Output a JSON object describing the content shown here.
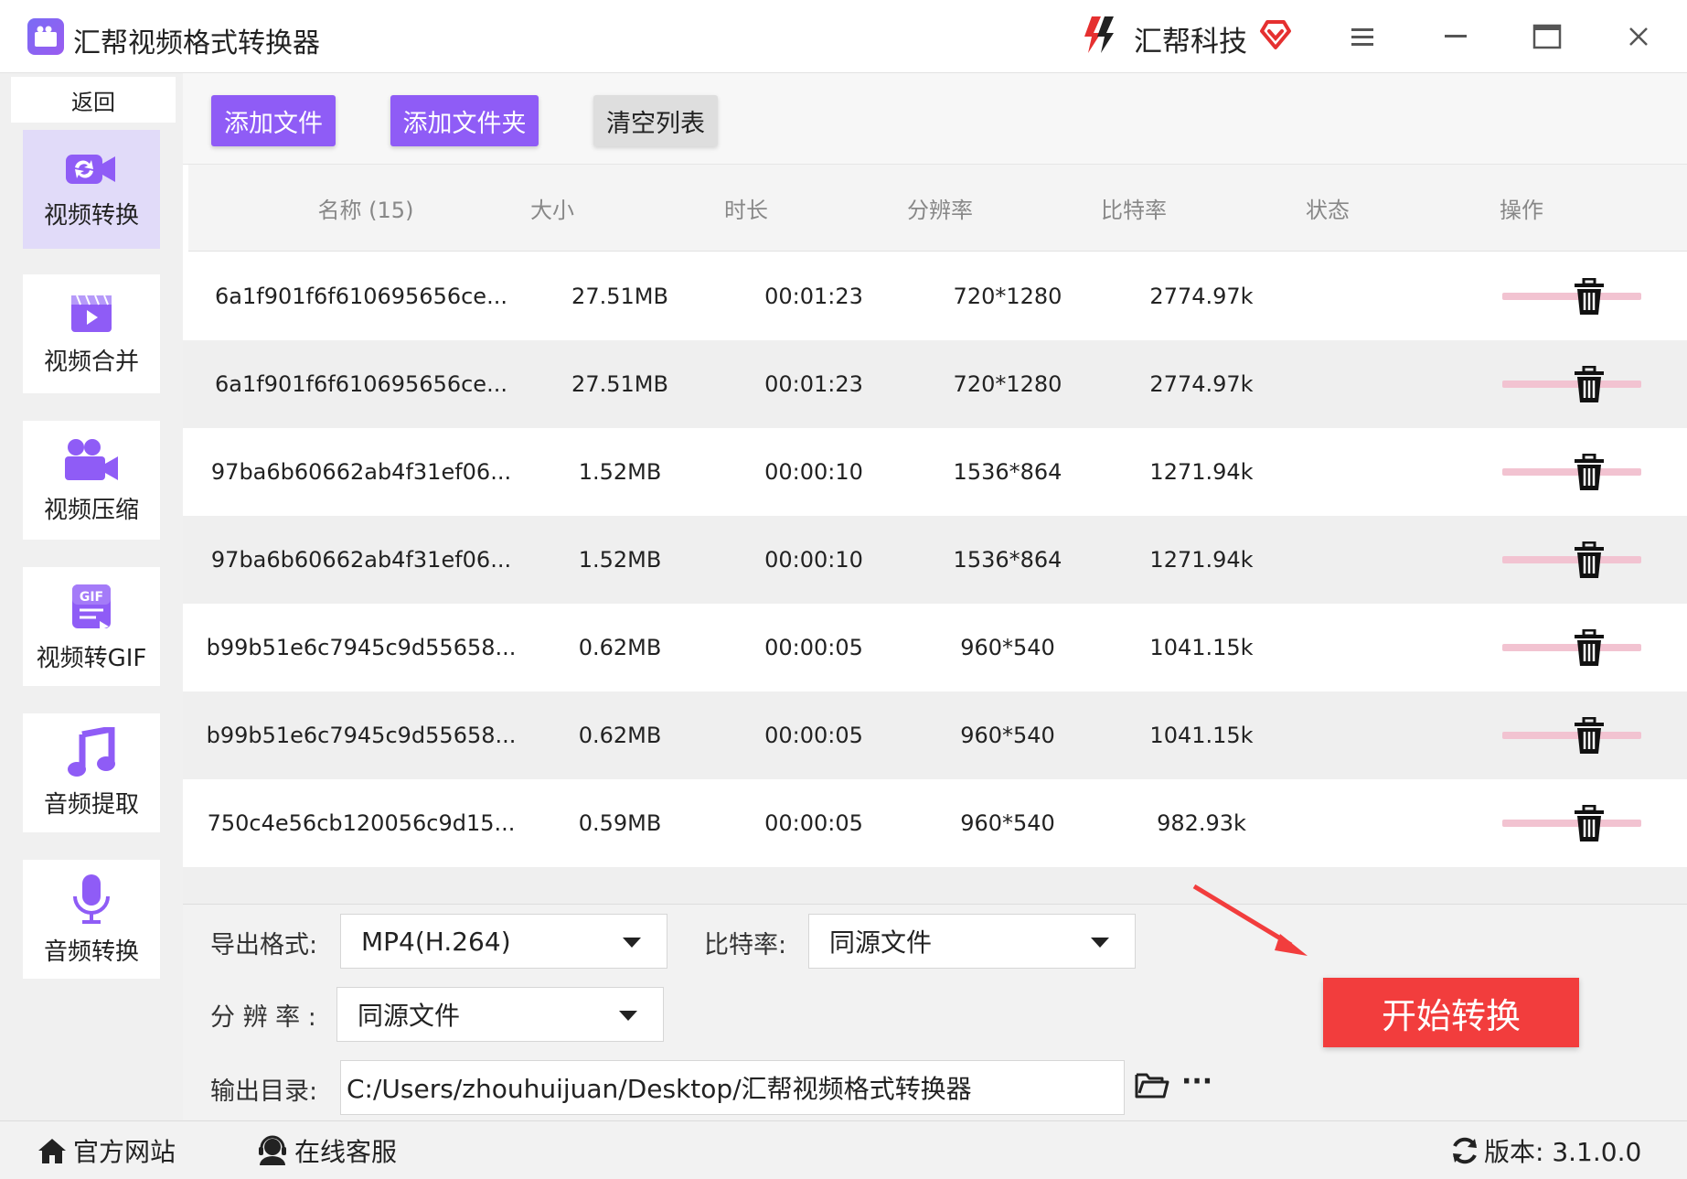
{
  "titlebar": {
    "app_title": "汇帮视频格式转换器",
    "brand_name": "汇帮科技",
    "icons": [
      "app-logo-icon",
      "brand-logo-icon",
      "brand-badge-icon",
      "menu-icon",
      "minimize-icon",
      "maximize-icon",
      "close-icon"
    ]
  },
  "sidebar": {
    "back_label": "返回",
    "items": [
      {
        "label": "视频转换",
        "icon": "video-convert-icon",
        "active": true
      },
      {
        "label": "视频合并",
        "icon": "video-merge-icon",
        "active": false
      },
      {
        "label": "视频压缩",
        "icon": "video-compress-icon",
        "active": false
      },
      {
        "label": "视频转GIF",
        "icon": "gif-icon",
        "active": false
      },
      {
        "label": "音频提取",
        "icon": "music-note-icon",
        "active": false
      },
      {
        "label": "音频转换",
        "icon": "microphone-icon",
        "active": false
      }
    ]
  },
  "toolbar": {
    "add_file": "添加文件",
    "add_folder": "添加文件夹",
    "clear_list": "清空列表"
  },
  "table": {
    "headers": {
      "name": "名称 (15)",
      "size": "大小",
      "duration": "时长",
      "resolution": "分辨率",
      "bitrate": "比特率",
      "status": "状态",
      "action": "操作"
    },
    "rows": [
      {
        "name": "6a1f901f6f610695656ce...",
        "size": "27.51MB",
        "duration": "00:01:23",
        "resolution": "720*1280",
        "bitrate": "2774.97k"
      },
      {
        "name": "6a1f901f6f610695656ce...",
        "size": "27.51MB",
        "duration": "00:01:23",
        "resolution": "720*1280",
        "bitrate": "2774.97k"
      },
      {
        "name": "97ba6b60662ab4f31ef06...",
        "size": "1.52MB",
        "duration": "00:00:10",
        "resolution": "1536*864",
        "bitrate": "1271.94k"
      },
      {
        "name": "97ba6b60662ab4f31ef06...",
        "size": "1.52MB",
        "duration": "00:00:10",
        "resolution": "1536*864",
        "bitrate": "1271.94k"
      },
      {
        "name": "b99b51e6c7945c9d55658...",
        "size": "0.62MB",
        "duration": "00:00:05",
        "resolution": "960*540",
        "bitrate": "1041.15k"
      },
      {
        "name": "b99b51e6c7945c9d55658...",
        "size": "0.62MB",
        "duration": "00:00:05",
        "resolution": "960*540",
        "bitrate": "1041.15k"
      },
      {
        "name": "750c4e56cb120056c9d15...",
        "size": "0.59MB",
        "duration": "00:00:05",
        "resolution": "960*540",
        "bitrate": "982.93k"
      }
    ]
  },
  "settings": {
    "format_label": "导出格式:",
    "format_value": "MP4(H.264)",
    "bitrate_label": "比特率:",
    "bitrate_value": "同源文件",
    "resolution_label": "分 辨 率 :",
    "resolution_value": "同源文件",
    "output_label": "输出目录:",
    "output_path": "C:/Users/zhouhuijuan/Desktop/汇帮视频格式转换器",
    "more_label": "···",
    "start_button": "开始转换"
  },
  "footer": {
    "website": "官方网站",
    "support": "在线客服",
    "version": "版本: 3.1.0.0"
  },
  "colors": {
    "accent_purple": "#8f5cf6",
    "start_red": "#f23d3d",
    "status_pink": "#f2c3d1",
    "sidebar_active": "#e1dbf9"
  }
}
